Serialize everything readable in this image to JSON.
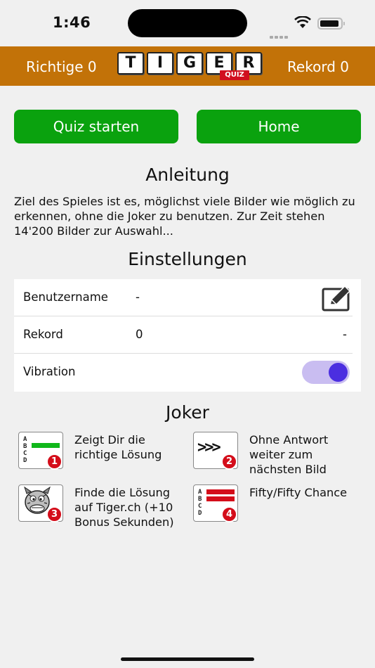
{
  "status_bar": {
    "time": "1:46"
  },
  "header": {
    "richtige_label": "Richtige 0",
    "rekord_label": "Rekord 0",
    "logo_letters": [
      "T",
      "I",
      "G",
      "E",
      "R"
    ],
    "logo_sub": "QUIZ"
  },
  "buttons": {
    "quiz_starten": "Quiz starten",
    "home": "Home"
  },
  "anleitung": {
    "title": "Anleitung",
    "text": "Ziel des Spieles ist es, möglichst viele Bilder wie möglich zu erkennen, ohne die Joker zu benutzen. Zur Zeit stehen 14'200 Bilder zur Auswahl..."
  },
  "einstellungen": {
    "title": "Einstellungen",
    "rows": [
      {
        "label": "Benutzername",
        "value": "-"
      },
      {
        "label": "Rekord",
        "value": "0",
        "right_value": "-"
      },
      {
        "label": "Vibration",
        "toggle_on": true
      }
    ]
  },
  "joker": {
    "title": "Joker",
    "items": [
      {
        "number": "1",
        "icon": "abcd-green-bar-icon",
        "text": "Zeigt Dir die richtige Lösung"
      },
      {
        "number": "2",
        "icon": "skip-arrows-icon",
        "glyph": ">>>",
        "text": "Ohne Antwort weiter zum nächsten Bild"
      },
      {
        "number": "3",
        "icon": "tiger-mascot-icon",
        "text": "Finde die Lösung auf Tiger.ch (+10 Bonus Sekunden)"
      },
      {
        "number": "4",
        "icon": "abcd-red-bars-icon",
        "text": "Fifty/Fifty Chance"
      }
    ]
  },
  "colors": {
    "header_bg": "#c27208",
    "button_bg": "#0aa20e",
    "toggle_track": "#c9bdf1",
    "toggle_knob": "#4b2ee0",
    "badge_red": "#d40d1a"
  }
}
